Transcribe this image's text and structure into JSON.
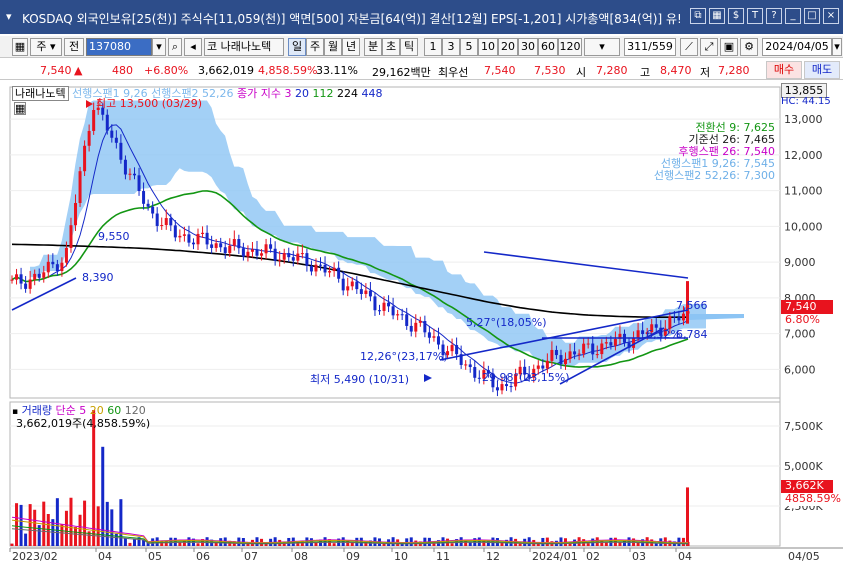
{
  "window": {
    "title": "KOSDAQ 외국인보유[25(천)] 주식수[11,059(천)] 액면[500] 자본금[64(억)] 결산[12월] EPS[-1,201] 시가총액[834(억)] 유!",
    "icons": [
      "stack-icon",
      "grid-icon",
      "dollar-icon",
      "text-icon",
      "help-icon",
      "minimize-icon",
      "maximize-icon",
      "close-icon"
    ]
  },
  "toolbar": {
    "type_label": "주",
    "prev_label": "전",
    "code_value": "137080",
    "stock_label": "코 나래나노텍",
    "periods": [
      "일",
      "주",
      "월",
      "년",
      "분",
      "초",
      "틱"
    ],
    "selected_period": "일",
    "intervals": [
      "1",
      "3",
      "5",
      "10",
      "20",
      "30",
      "60",
      "120"
    ],
    "page_counter": "311/559",
    "date_value": "2024/04/05"
  },
  "quote": {
    "price": "7,540",
    "change": "480",
    "change_pct": "+6.80%",
    "volume": "3,662,019",
    "volume_pct": "4,858.59%",
    "turnover": "33.11%",
    "amount": "29,162백만",
    "best_label": "최우선",
    "ask": "7,540",
    "bid": "7,530",
    "open_label": "시",
    "open": "7,280",
    "high_label": "고",
    "high": "8,470",
    "low_label": "저",
    "low": "7,280",
    "buy_label": "매수",
    "sell_label": "매도"
  },
  "price_panel": {
    "name": "나래나노텍",
    "legend_items": [
      {
        "label": "선행스팬1 9,26",
        "color": "#9ecbf2"
      },
      {
        "label": "선행스팬2 52,26",
        "color": "#9ecbf2"
      },
      {
        "label": "종가 지수 3",
        "color": "#c800c8"
      },
      {
        "label": "20",
        "color": "#1428c8"
      },
      {
        "label": "112",
        "color": "#139613"
      },
      {
        "label": "224",
        "color": "#000000"
      },
      {
        "label": "448",
        "color": "#1428c8"
      }
    ],
    "ichimoku_legend": [
      {
        "label": "전환선 9: 7,625",
        "color": "#139613"
      },
      {
        "label": "기준선 26: 7,465",
        "color": "#1a1a1a"
      },
      {
        "label": "후행스팬 26: 7,540",
        "color": "#c800c8"
      },
      {
        "label": "선행스팬1 9,26: 7,545",
        "color": "#6fb0e8"
      },
      {
        "label": "선행스팬2 52,26: 7,300",
        "color": "#6fb0e8"
      }
    ],
    "annotations": {
      "high": "최고 13,500 (03/29)",
      "low": "최저 5,490 (10/31)",
      "a1": "9,550",
      "a2": "8,390",
      "a3": "12,26°(23,17%)",
      "a4": "29,98°(23,15%)",
      "a5": "5,27°(18,05%)",
      "a6": "7,566",
      "a7": "6,784",
      "a8": "6,32%"
    },
    "y_ticks": [
      "13,000",
      "12,000",
      "11,000",
      "10,000",
      "9,000",
      "8,000",
      "7,000",
      "6,000"
    ],
    "top_box": "13,855",
    "top_box_sub": "HC: 44.15",
    "price_box": "7,540",
    "price_box_pct": "6.80%"
  },
  "volume_panel": {
    "legend_items": [
      {
        "label": "거래량",
        "color": "#1428c8"
      },
      {
        "label": "단순 5",
        "color": "#c800c8"
      },
      {
        "label": "20",
        "color": "#c8a000"
      },
      {
        "label": "60",
        "color": "#139613"
      },
      {
        "label": "120",
        "color": "#6a6a6a"
      }
    ],
    "current": "3,662,019주(4,858.59%)",
    "y_ticks": [
      "7,500K",
      "5,000K",
      "2,500K"
    ],
    "vol_box": "3,662K",
    "vol_box_pct": "4858.59%"
  },
  "x_axis": [
    "2023/02",
    "04",
    "05",
    "06",
    "07",
    "08",
    "09",
    "10",
    "11",
    "12",
    "2024/01",
    "02",
    "03",
    "04",
    "04/05"
  ],
  "chart_data": {
    "type": "candlestick",
    "title": "나래나노텍",
    "x_range": [
      "2023/02",
      "2024/04/05"
    ],
    "ylim": [
      5200,
      13900
    ],
    "close_path": [
      8400,
      8600,
      9200,
      13500,
      12000,
      10500,
      9800,
      9600,
      9400,
      9300,
      9200,
      9000,
      8600,
      8100,
      7600,
      7200,
      6600,
      6000,
      5490,
      5900,
      6300,
      6500,
      6700,
      6900,
      7200,
      7540
    ],
    "ma224": [
      9500,
      9480,
      9450,
      9420,
      9380,
      9320,
      9240,
      9150,
      9030,
      8880,
      8700,
      8500,
      8300,
      8100,
      7900,
      7730,
      7600,
      7520,
      7480,
      7460,
      7460
    ],
    "volume_ylim": [
      0,
      9000000
    ],
    "volume_last": 3662019
  }
}
